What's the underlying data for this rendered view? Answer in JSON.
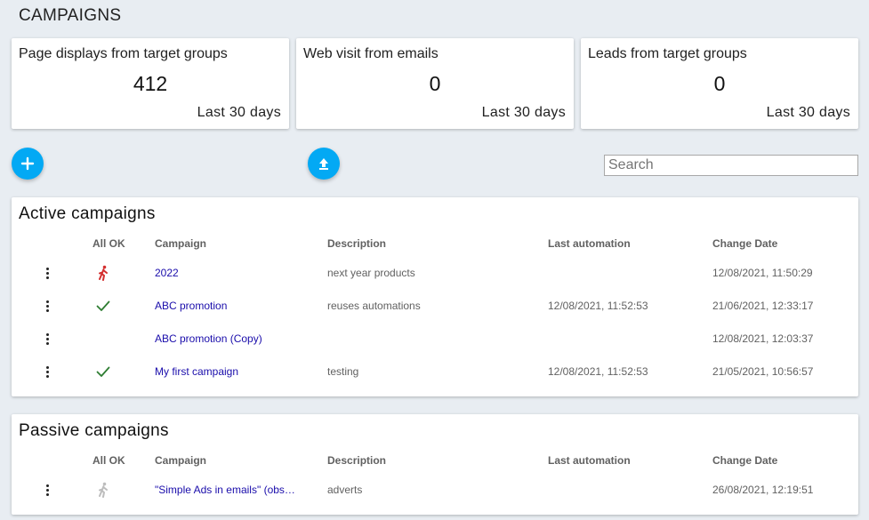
{
  "page": {
    "title": "CAMPAIGNS"
  },
  "stats": [
    {
      "title": "Page displays from target groups",
      "value": "412",
      "period": "Last 30 days"
    },
    {
      "title": "Web visit from emails",
      "value": "0",
      "period": "Last 30 days"
    },
    {
      "title": "Leads from target groups",
      "value": "0",
      "period": "Last 30 days"
    }
  ],
  "toolbar": {
    "add_icon": "plus-icon",
    "upload_icon": "upload-icon",
    "search_placeholder": "Search"
  },
  "columns": {
    "all_ok": "All OK",
    "campaign": "Campaign",
    "description": "Description",
    "last_automation": "Last automation",
    "change_date": "Change Date"
  },
  "active": {
    "title": "Active campaigns",
    "rows": [
      {
        "status": "running-error",
        "campaign": "2022",
        "description": "next year products",
        "last_automation": "",
        "change_date": "12/08/2021, 11:50:29"
      },
      {
        "status": "ok",
        "campaign": "ABC promotion",
        "description": "reuses automations",
        "last_automation": "12/08/2021, 11:52:53",
        "change_date": "21/06/2021, 12:33:17"
      },
      {
        "status": "none",
        "campaign": "ABC promotion (Copy)",
        "description": "",
        "last_automation": "",
        "change_date": "12/08/2021, 12:03:37"
      },
      {
        "status": "ok",
        "campaign": "My first campaign",
        "description": "testing",
        "last_automation": "12/08/2021, 11:52:53",
        "change_date": "21/05/2021, 10:56:57"
      }
    ]
  },
  "passive": {
    "title": "Passive campaigns",
    "rows": [
      {
        "status": "running-inactive",
        "campaign": "\"Simple Ads in emails\" (obs…",
        "description": "adverts",
        "last_automation": "",
        "change_date": "26/08/2021, 12:19:51"
      }
    ]
  },
  "colors": {
    "accent": "#03a9f4",
    "link": "#1a0dab",
    "ok": "#2e7d32",
    "error": "#d32f2f",
    "inactive": "#bdbdbd"
  }
}
